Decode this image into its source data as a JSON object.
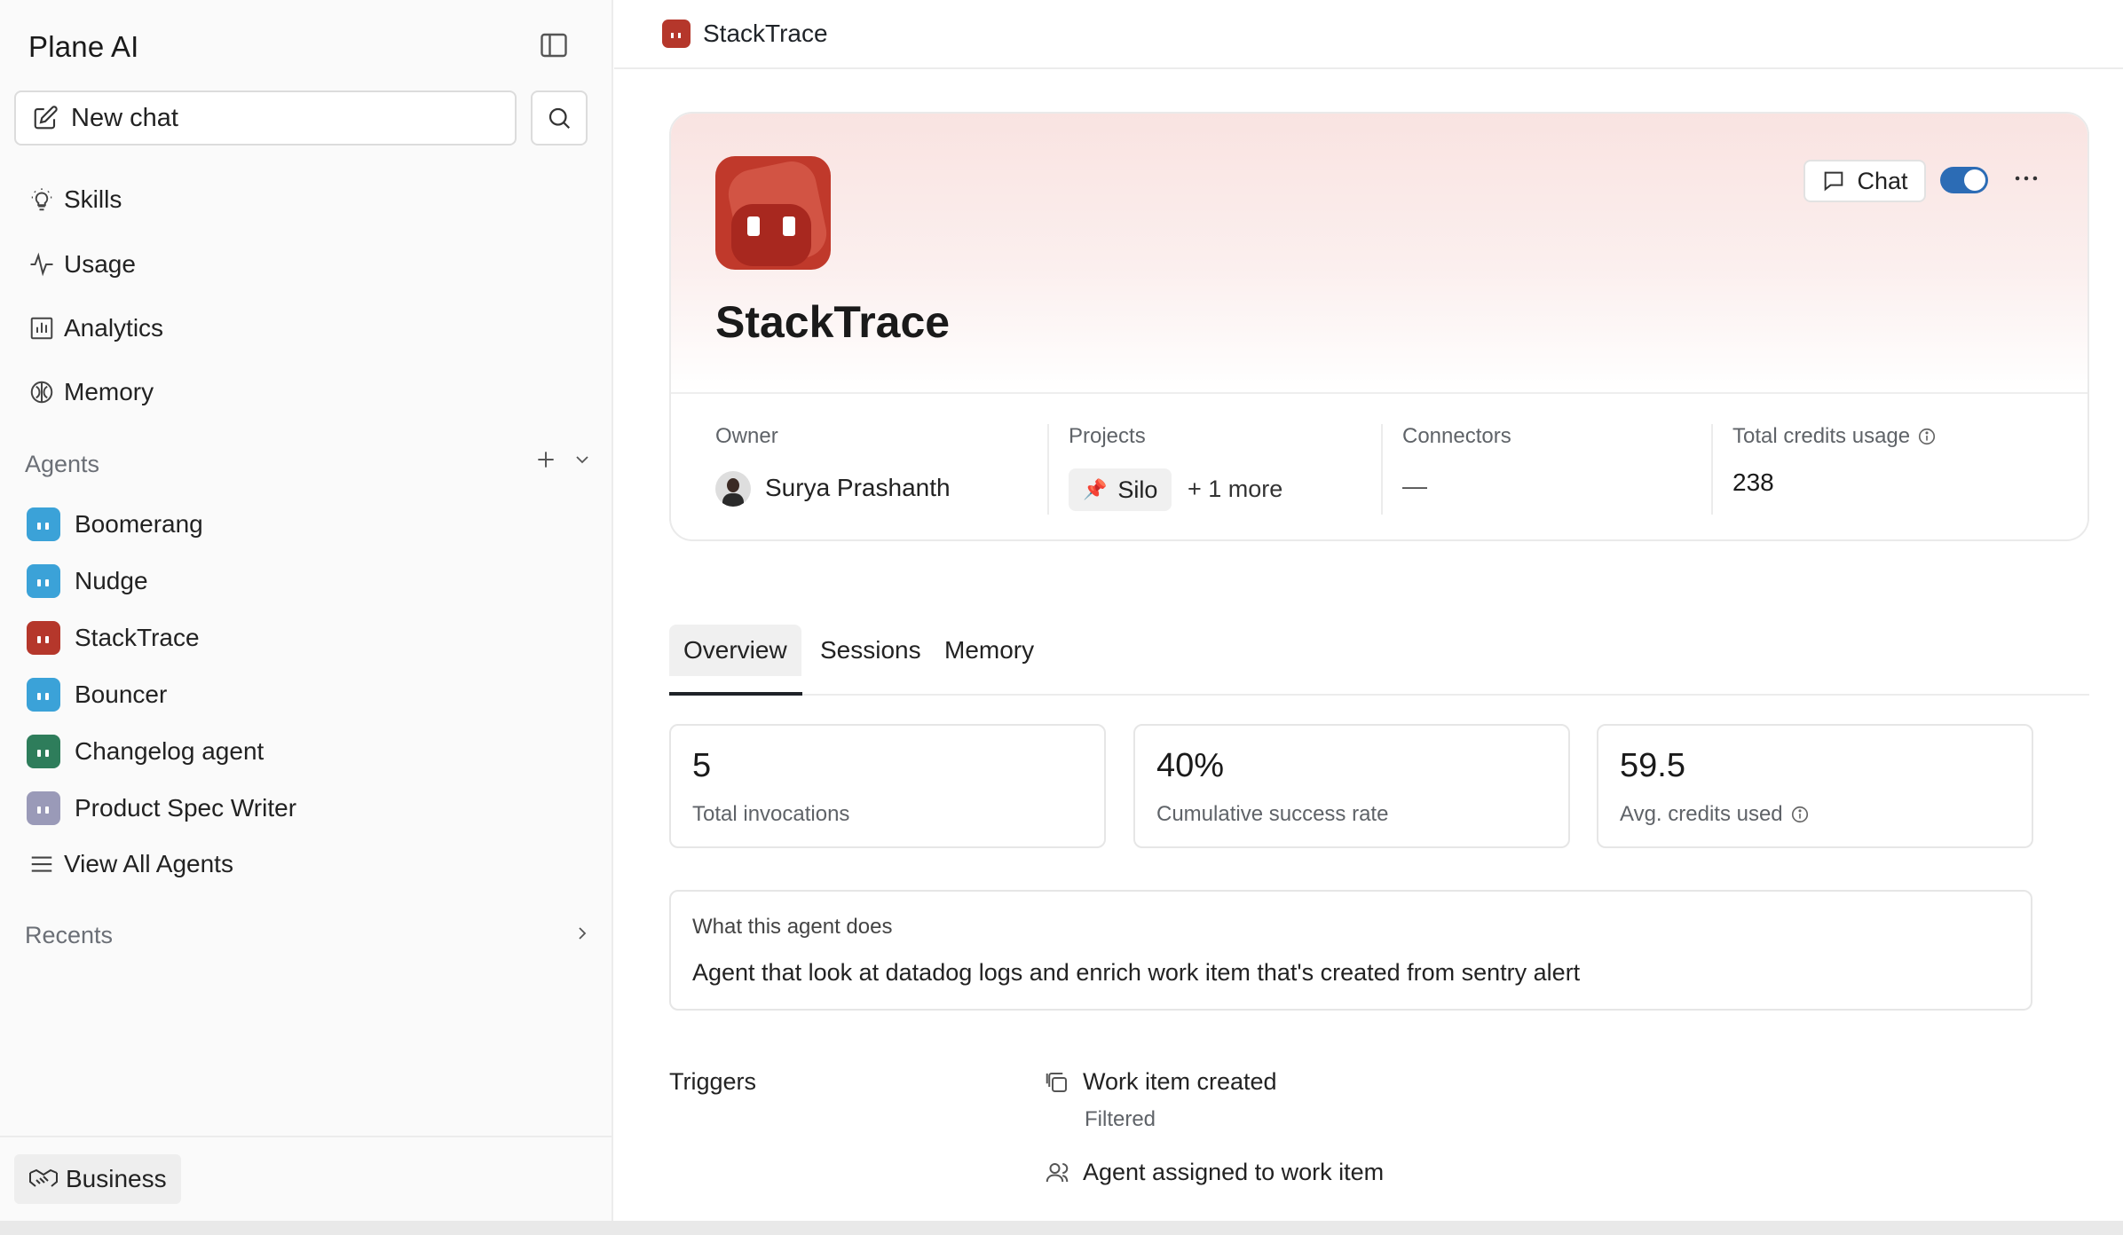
{
  "sidebar": {
    "title": "Plane AI",
    "new_chat_label": "New chat",
    "nav": [
      {
        "label": "Skills",
        "icon": "lightbulb-icon"
      },
      {
        "label": "Usage",
        "icon": "activity-icon"
      },
      {
        "label": "Analytics",
        "icon": "chart-icon"
      },
      {
        "label": "Memory",
        "icon": "brain-icon"
      }
    ],
    "agents_label": "Agents",
    "agents": [
      {
        "name": "Boomerang",
        "color": "#3ba2d8"
      },
      {
        "name": "Nudge",
        "color": "#3ba2d8"
      },
      {
        "name": "StackTrace",
        "color": "#b5372b"
      },
      {
        "name": "Bouncer",
        "color": "#3ba2d8"
      },
      {
        "name": "Changelog agent",
        "color": "#2e7d5b"
      },
      {
        "name": "Product Spec Writer",
        "color": "#9a9ab8"
      }
    ],
    "view_all_label": "View All Agents",
    "recents_label": "Recents",
    "workspace_label": "Business"
  },
  "topbar": {
    "title": "StackTrace"
  },
  "agent": {
    "name": "StackTrace",
    "chat_label": "Chat",
    "enabled": true,
    "accent_color": "#b5372b",
    "owner_label": "Owner",
    "owner_name": "Surya Prashanth",
    "projects_label": "Projects",
    "project_chip": "Silo",
    "projects_more": "+ 1 more",
    "connectors_label": "Connectors",
    "connectors_value": "—",
    "credits_label": "Total credits usage",
    "credits_value": "238"
  },
  "tabs": [
    {
      "label": "Overview",
      "active": true
    },
    {
      "label": "Sessions",
      "active": false
    },
    {
      "label": "Memory",
      "active": false
    }
  ],
  "stats": [
    {
      "value": "5",
      "label": "Total invocations"
    },
    {
      "value": "40%",
      "label": "Cumulative success rate"
    },
    {
      "value": "59.5",
      "label": "Avg. credits used"
    }
  ],
  "description": {
    "label": "What this agent does",
    "text": "Agent that look at datadog logs and enrich work item that's created from sentry alert"
  },
  "triggers": {
    "label": "Triggers",
    "items": [
      {
        "label": "Work item created",
        "sub": "Filtered"
      },
      {
        "label": "Agent assigned to work item"
      }
    ]
  }
}
